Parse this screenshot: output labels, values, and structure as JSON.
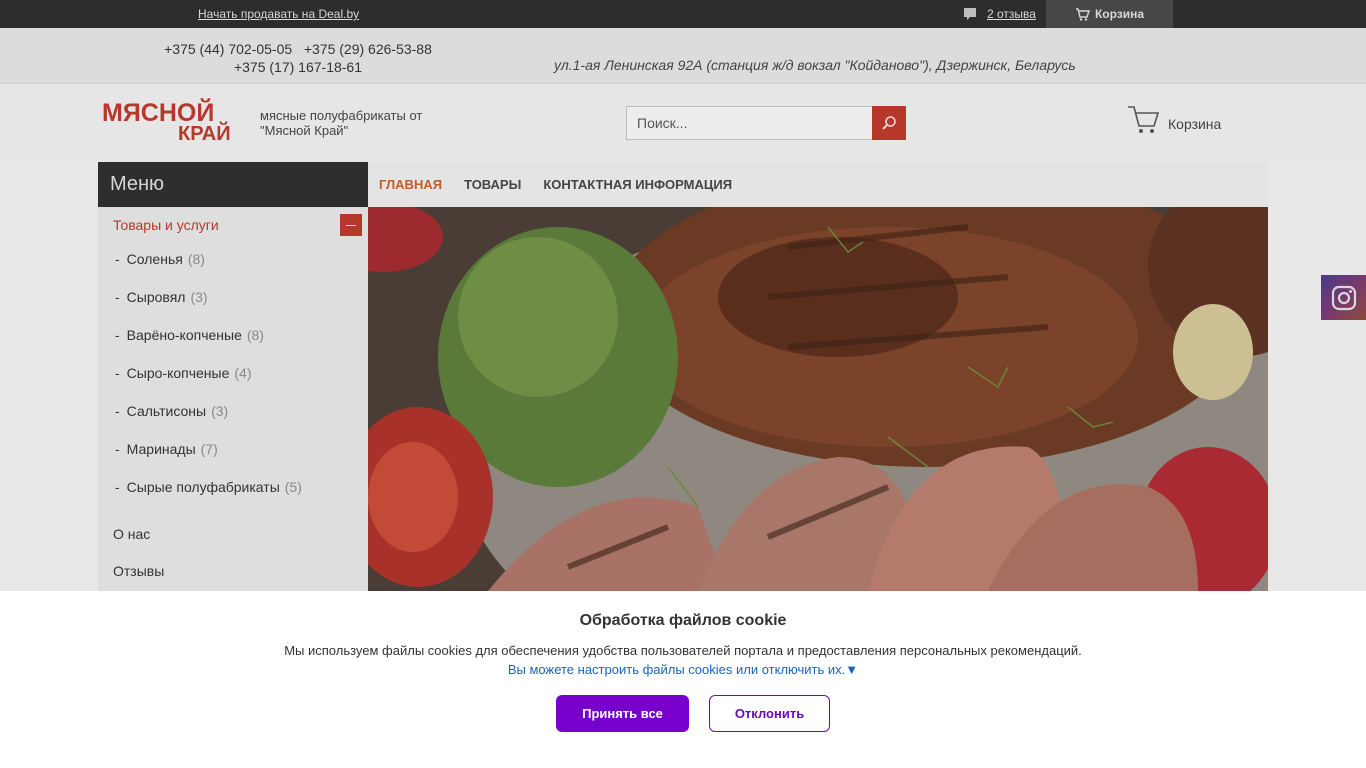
{
  "topbar": {
    "sell_link": "Начать продавать на Deal.by",
    "reviews_link": "2 отзыва",
    "cart_label": "Корзина"
  },
  "contacts": {
    "phone_1": "+375 (44) 702-05-05",
    "phone_2": "+375 (29) 626-53-88",
    "phone_3": "+375 (17) 167-18-61",
    "address": "ул.1-ая Ленинская 92А (станция ж/д вокзал \"Койданово\"), Дзержинск, Беларусь"
  },
  "header": {
    "logo_line1": "МЯСНОЙ",
    "logo_line2": "КРАЙ",
    "tagline": "мясные полуфабрикаты от \"Мясной Край\"",
    "search_placeholder": "Поиск...",
    "cart_label": "Корзина"
  },
  "sidebar": {
    "title": "Меню",
    "category": "Товары и услуги",
    "subitems": [
      {
        "label": "Соленья",
        "count": "(8)"
      },
      {
        "label": "Сыровял",
        "count": "(3)"
      },
      {
        "label": "Варёно-копченые",
        "count": "(8)"
      },
      {
        "label": "Сыро-копченые",
        "count": "(4)"
      },
      {
        "label": "Сальтисоны",
        "count": "(3)"
      },
      {
        "label": "Маринады",
        "count": "(7)"
      },
      {
        "label": "Сырые полуфабрикаты",
        "count": "(5)"
      }
    ],
    "about": "О нас",
    "reviews": "Отзывы"
  },
  "nav": {
    "tabs": [
      {
        "label": "ГЛАВНАЯ"
      },
      {
        "label": "ТОВАРЫ"
      },
      {
        "label": "КОНТАКТНАЯ ИНФОРМАЦИЯ"
      }
    ]
  },
  "cookie": {
    "title": "Обработка файлов cookie",
    "description": "Мы используем файлы cookies для обеспечения удобства пользователей портала и предоставления персональных рекомендаций.",
    "settings_link": "Вы можете настроить файлы cookies или отключить их.▼",
    "accept_label": "Принять все",
    "decline_label": "Отклонить"
  },
  "colors": {
    "brand": "#b6382b",
    "accent_purple": "#7700cc",
    "nav_active": "#c05d28",
    "link_blue": "#1a63b8"
  },
  "icons": [
    "comment-icon",
    "cart-icon",
    "search-icon",
    "instagram-icon",
    "minus-icon"
  ]
}
